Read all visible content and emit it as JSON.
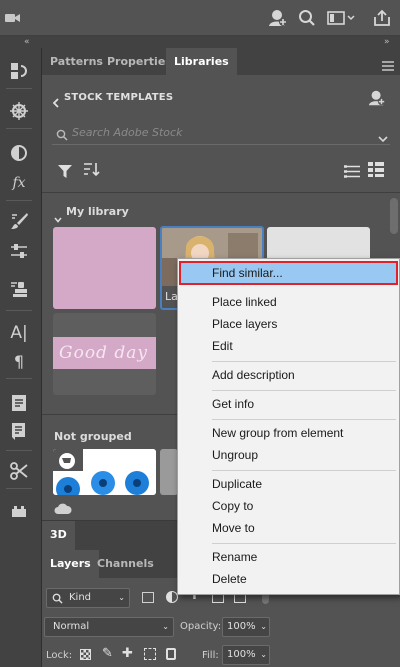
{
  "panel_tabs": [
    "Patterns",
    "Properties",
    "Libraries"
  ],
  "library": {
    "title": "STOCK TEMPLATES",
    "search_placeholder": "Search Adobe Stock",
    "my_library_label": "My library",
    "not_grouped_label": "Not grouped",
    "card_good_day_text": "Good day",
    "card_layer_label": "Lay"
  },
  "bottom_tabs": {
    "three_d": "3D",
    "layers": "Layers",
    "channels": "Channels"
  },
  "layers_controls": {
    "kind": "Kind",
    "blend_mode": "Normal",
    "opacity_label": "Opacity:",
    "opacity_value": "100%",
    "lock_label": "Lock:",
    "fill_label": "Fill:",
    "fill_value": "100%"
  },
  "context_menu": {
    "highlighted": "Find similar...",
    "group1": [
      "Place linked",
      "Place layers",
      "Edit"
    ],
    "group2": [
      "Add description"
    ],
    "group3": [
      "Get info"
    ],
    "group4": [
      "New group from element",
      "Ungroup"
    ],
    "group5": [
      "Duplicate",
      "Copy to",
      "Move to"
    ],
    "group6": [
      "Rename",
      "Delete"
    ]
  },
  "colors": {
    "app_bg": "#535353",
    "dark_bg": "#424242",
    "card_pink": "#d4a8c7",
    "card_gray": "#e2e2e2",
    "menu_highlight": "#99c9f2",
    "menu_highlight_border": "#e0232a",
    "selected_card_border": "#4a7fc0"
  }
}
